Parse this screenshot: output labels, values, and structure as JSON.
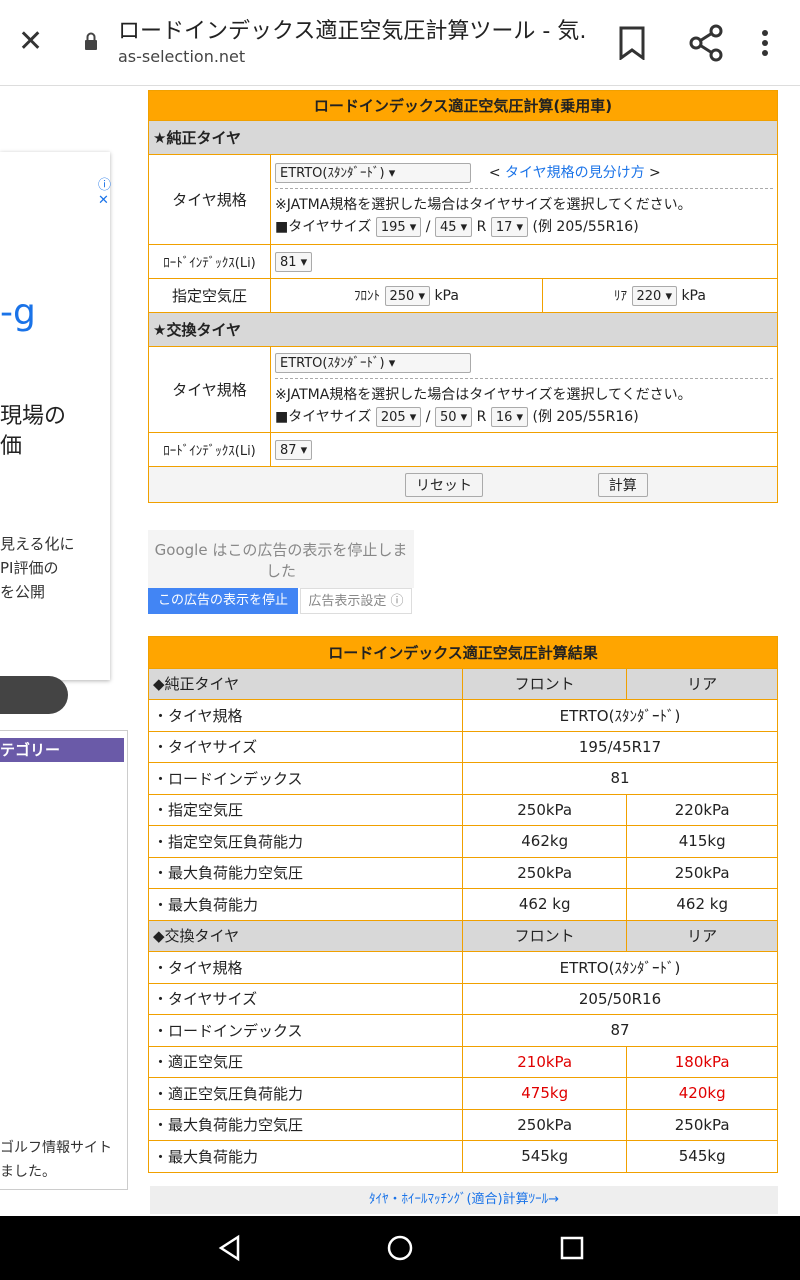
{
  "browser": {
    "title": "ロードインデックス適正空気圧計算ツール - 気…",
    "url": "as-selection.net"
  },
  "left": {
    "ad_g": "-g",
    "ad_t1": "現場の\n価",
    "ad_t2": "見える化に\nPI評価の\nを公開",
    "category": "テゴリー",
    "golf": "ゴルフ情報サイト\nました。"
  },
  "form": {
    "title": "ロードインデックス適正空気圧計算(乗用車)",
    "stock_header": "★純正タイヤ",
    "replace_header": "★交換タイヤ",
    "tire_spec_label": "タイヤ規格",
    "load_index_label": "ﾛｰﾄﾞｲﾝﾃﾞｯｸｽ(Li)",
    "pressure_label": "指定空気圧",
    "spec_select": "ETRTO(ｽﾀﾝﾀﾞｰﾄﾞ)",
    "guide_prefix": "< ",
    "guide_link": "タイヤ規格の見分け方",
    "guide_suffix": " >",
    "note": "※JATMA規格を選択した場合はタイヤサイズを選択してください。",
    "size_label": "■タイヤサイズ",
    "slash": "/",
    "r": "R",
    "example": "(例 205/55R16)",
    "stock_size": [
      "195",
      "45",
      "17"
    ],
    "stock_li": "81",
    "front_label": "ﾌﾛﾝﾄ",
    "rear_label": "ﾘｱ",
    "front_pressure": "250",
    "rear_pressure": "220",
    "kpa": "kPa",
    "replace_size": [
      "205",
      "50",
      "16"
    ],
    "replace_li": "87",
    "reset": "リセット",
    "calc": "計算"
  },
  "ad": {
    "msg": "Google はこの広告の表示を停止しました",
    "stop": "この広告の表示を停止",
    "settings": "広告表示設定 ⓘ"
  },
  "result": {
    "title": "ロードインデックス適正空気圧計算結果",
    "stock_header": "◆純正タイヤ",
    "replace_header": "◆交換タイヤ",
    "front": "フロント",
    "rear": "リア",
    "stock_rows": [
      {
        "label": "・タイヤ規格",
        "span": "ETRTO(ｽﾀﾝﾀﾞｰﾄﾞ)"
      },
      {
        "label": "・タイヤサイズ",
        "span": "195/45R17"
      },
      {
        "label": "・ロードインデックス",
        "span": "81"
      },
      {
        "label": "・指定空気圧",
        "f": "250kPa",
        "r": "220kPa"
      },
      {
        "label": "・指定空気圧負荷能力",
        "f": "462kg",
        "r": "415kg"
      },
      {
        "label": "・最大負荷能力空気圧",
        "f": "250kPa",
        "r": "250kPa"
      },
      {
        "label": "・最大負荷能力",
        "f": "462 kg",
        "r": "462 kg"
      }
    ],
    "replace_rows": [
      {
        "label": "・タイヤ規格",
        "span": "ETRTO(ｽﾀﾝﾀﾞｰﾄﾞ)"
      },
      {
        "label": "・タイヤサイズ",
        "span": "205/50R16"
      },
      {
        "label": "・ロードインデックス",
        "span": "87"
      },
      {
        "label": "・適正空気圧",
        "f": "210kPa",
        "r": "180kPa",
        "red": true
      },
      {
        "label": "・適正空気圧負荷能力",
        "f": "475kg",
        "r": "420kg",
        "red": true
      },
      {
        "label": "・最大負荷能力空気圧",
        "f": "250kPa",
        "r": "250kPa"
      },
      {
        "label": "・最大負荷能力",
        "f": "545kg",
        "r": "545kg"
      }
    ]
  },
  "footer_link": "ﾀｲﾔ・ﾎｲｰﾙﾏｯﾁﾝｸﾞ(適合)計算ﾂｰﾙ→"
}
